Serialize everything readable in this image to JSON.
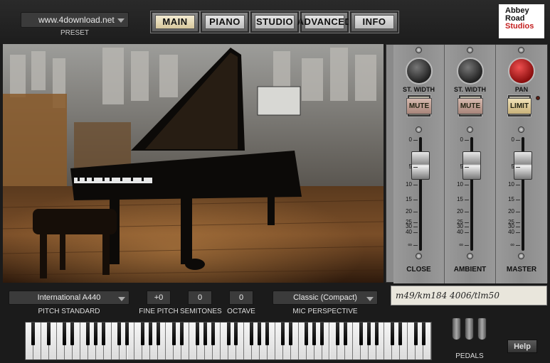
{
  "preset": {
    "value": "www.4download.net",
    "label": "PRESET"
  },
  "tabs": [
    {
      "label": "MAIN",
      "active": true
    },
    {
      "label": "PIANO",
      "active": false
    },
    {
      "label": "STUDIO",
      "active": false
    },
    {
      "label": "ADVANCED",
      "active": false
    },
    {
      "label": "INFO",
      "active": false
    }
  ],
  "logo": {
    "line1": "Abbey",
    "line2": "Road",
    "line3": "Studios"
  },
  "mixer": {
    "channels": [
      {
        "knob_label": "ST. WIDTH",
        "button_label": "MUTE",
        "name": "CLOSE",
        "fader_db": 5
      },
      {
        "knob_label": "ST. WIDTH",
        "button_label": "MUTE",
        "name": "AMBIENT",
        "fader_db": 5
      },
      {
        "knob_label": "PAN",
        "button_label": "LIMIT",
        "name": "MASTER",
        "fader_db": 5
      }
    ],
    "scale": [
      "0",
      "5",
      "10",
      "15",
      "20",
      "25",
      "30",
      "40",
      "∞"
    ]
  },
  "controls": {
    "pitch_standard": {
      "value": "International  A440",
      "label": "PITCH STANDARD"
    },
    "fine_pitch": {
      "value": "+0",
      "label": "FINE PITCH"
    },
    "semitones": {
      "value": "0",
      "label": "SEMITONES"
    },
    "octave": {
      "value": "0",
      "label": "OCTAVE"
    },
    "mic_perspective": {
      "value": "Classic (Compact)",
      "label": "MIC PERSPECTIVE"
    }
  },
  "mic_note": "m49/km184  4006/tlm50",
  "pedals_label": "PEDALS",
  "help_label": "Help",
  "colors": {
    "active_tab": "#f4ecd2",
    "mute_button": "#c7a69a",
    "limit_button": "#e6d3a0",
    "pan_knob": "#d32a2a"
  },
  "icons": [
    "dropdown-arrow-icon",
    "knob-icon",
    "screw-icon",
    "fader-icon",
    "pedal-icon"
  ]
}
